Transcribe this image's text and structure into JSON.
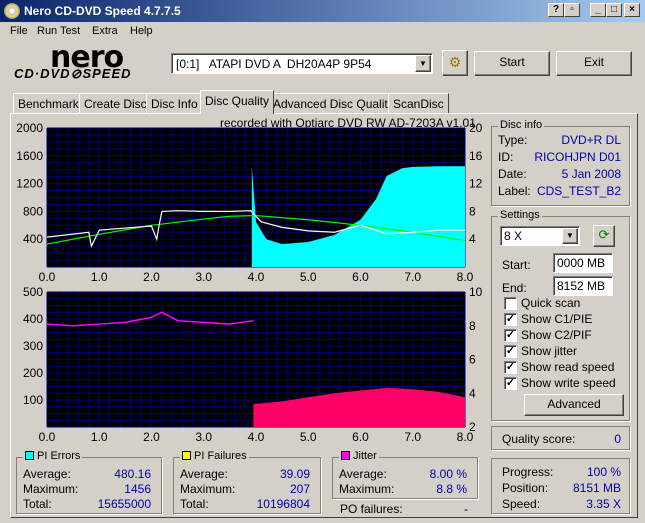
{
  "window": {
    "title": "Nero CD-DVD Speed 4.7.7.5"
  },
  "menu": [
    "File",
    "Run Test",
    "Extra",
    "Help"
  ],
  "logo": {
    "brand": "nero",
    "product": "CD·DVD⊘SPEED"
  },
  "drive": {
    "selected": "[0:1]   ATAPI DVD A  DH20A4P 9P54"
  },
  "buttons": {
    "start": "Start",
    "exit": "Exit",
    "advanced": "Advanced"
  },
  "tabs": [
    {
      "label": "Benchmark"
    },
    {
      "label": "Create Disc"
    },
    {
      "label": "Disc Info"
    },
    {
      "label": "Disc Quality",
      "active": true
    },
    {
      "label": "Advanced Disc Quality"
    },
    {
      "label": "ScanDisc"
    }
  ],
  "recorded_with": "recorded with Optiarc DVD RW AD-7203A  v1.01",
  "disc_info": {
    "title": "Disc info",
    "rows": [
      {
        "label": "Type:",
        "value": "DVD+R DL"
      },
      {
        "label": "ID:",
        "value": "RICOHJPN D01"
      },
      {
        "label": "Date:",
        "value": "5 Jan 2008"
      },
      {
        "label": "Label:",
        "value": "CDS_TEST_B2"
      }
    ]
  },
  "settings": {
    "title": "Settings",
    "speed": "8 X",
    "start_label": "Start:",
    "start_value": "0000 MB",
    "end_label": "End:",
    "end_value": "8152 MB",
    "checkboxes": [
      {
        "label": "Quick scan",
        "checked": false
      },
      {
        "label": "Show C1/PIE",
        "checked": true
      },
      {
        "label": "Show C2/PIF",
        "checked": true
      },
      {
        "label": "Show jitter",
        "checked": true
      },
      {
        "label": "Show read speed",
        "checked": true
      },
      {
        "label": "Show write speed",
        "checked": true
      }
    ]
  },
  "quality": {
    "label": "Quality score:",
    "value": "0"
  },
  "progress": {
    "rows": [
      {
        "label": "Progress:",
        "value": "100 %"
      },
      {
        "label": "Position:",
        "value": "8151 MB"
      },
      {
        "label": "Speed:",
        "value": "3.35 X"
      }
    ]
  },
  "pi_errors": {
    "title": "PI Errors",
    "color": "#00ffff",
    "rows": [
      {
        "label": "Average:",
        "value": "480.16"
      },
      {
        "label": "Maximum:",
        "value": "1456"
      },
      {
        "label": "Total:",
        "value": "15655000"
      }
    ]
  },
  "pi_failures": {
    "title": "PI Failures",
    "color": "#ffff00",
    "rows": [
      {
        "label": "Average:",
        "value": "39.09"
      },
      {
        "label": "Maximum:",
        "value": "207"
      },
      {
        "label": "Total:",
        "value": "10196804"
      }
    ]
  },
  "jitter": {
    "title": "Jitter",
    "color": "#ff00ff",
    "rows": [
      {
        "label": "Average:",
        "value": "8.00 %"
      },
      {
        "label": "Maximum:",
        "value": "8.8 %"
      }
    ]
  },
  "po_failures": {
    "label": "PO failures:",
    "value": "-"
  },
  "chart_data": [
    {
      "type": "area",
      "series_colors": {
        "pi_errors": "#00ffff",
        "read_speed": "#ffffff",
        "write_speed": "#00ff00"
      },
      "xlim": [
        0,
        8
      ],
      "ylim": [
        0,
        2000
      ],
      "y2lim": [
        0,
        20
      ],
      "x_ticks": [
        "0.0",
        "1.0",
        "2.0",
        "3.0",
        "4.0",
        "5.0",
        "6.0",
        "7.0",
        "8.0"
      ],
      "y_ticks": [
        "400",
        "800",
        "1200",
        "1600",
        "2000"
      ],
      "y2_ticks": [
        "4",
        "8",
        "12",
        "16",
        "20"
      ],
      "series": [
        {
          "name": "PI Errors",
          "x": [
            3.92,
            4.0,
            4.1,
            4.2,
            4.5,
            5.0,
            5.5,
            6.0,
            6.3,
            6.5,
            6.8,
            7.0,
            7.5,
            8.0
          ],
          "values": [
            1450,
            650,
            520,
            400,
            330,
            360,
            460,
            680,
            980,
            1310,
            1420,
            1440,
            1450,
            1450
          ]
        },
        {
          "name": "Read speed",
          "x": [
            0,
            0.8,
            0.85,
            1.0,
            1.5,
            2.0,
            2.1,
            2.15,
            2.2,
            2.5,
            3.0,
            3.5,
            3.9,
            4.1,
            4.5,
            5.0,
            5.5,
            6.0,
            6.5,
            7.0,
            7.5,
            8.0
          ],
          "values": [
            4.3,
            5.0,
            3.0,
            5.3,
            5.6,
            5.9,
            4.0,
            6.2,
            8.0,
            8.1,
            8.0,
            8.0,
            8.1,
            6.5,
            5.7,
            5.2,
            5.0,
            6.0,
            4.8,
            5.0,
            5.3,
            5.3
          ]
        },
        {
          "name": "Write speed",
          "x": [
            0,
            1,
            2,
            3,
            3.5,
            4,
            5,
            6,
            7,
            8
          ],
          "values": [
            3.3,
            4.7,
            6.0,
            6.9,
            7.3,
            7.4,
            6.8,
            6.0,
            5.0,
            3.8
          ]
        }
      ]
    },
    {
      "type": "bar",
      "series_colors": {
        "pi_failures": "#ff0066",
        "jitter": "#ff00ff"
      },
      "xlim": [
        0,
        8
      ],
      "ylim": [
        0,
        500
      ],
      "y2lim": [
        2,
        10
      ],
      "x_ticks": [
        "0.0",
        "1.0",
        "2.0",
        "3.0",
        "4.0",
        "5.0",
        "6.0",
        "7.0",
        "8.0"
      ],
      "y_ticks": [
        "100",
        "200",
        "300",
        "400",
        "500"
      ],
      "y2_ticks": [
        "2",
        "4",
        "6",
        "8",
        "10"
      ],
      "series": [
        {
          "name": "PI Failures",
          "x": [
            3.95,
            4.5,
            5.0,
            5.5,
            6.0,
            6.5,
            7.0,
            7.5,
            8.0
          ],
          "values": [
            85,
            95,
            110,
            125,
            135,
            145,
            140,
            130,
            110
          ]
        },
        {
          "name": "Jitter",
          "x": [
            0,
            0.5,
            1.0,
            1.5,
            2.0,
            2.2,
            2.5,
            3.0,
            3.5,
            3.95
          ],
          "values": [
            8.1,
            8.0,
            8.1,
            8.2,
            8.5,
            8.8,
            8.3,
            8.2,
            8.1,
            8.3
          ]
        }
      ]
    }
  ]
}
